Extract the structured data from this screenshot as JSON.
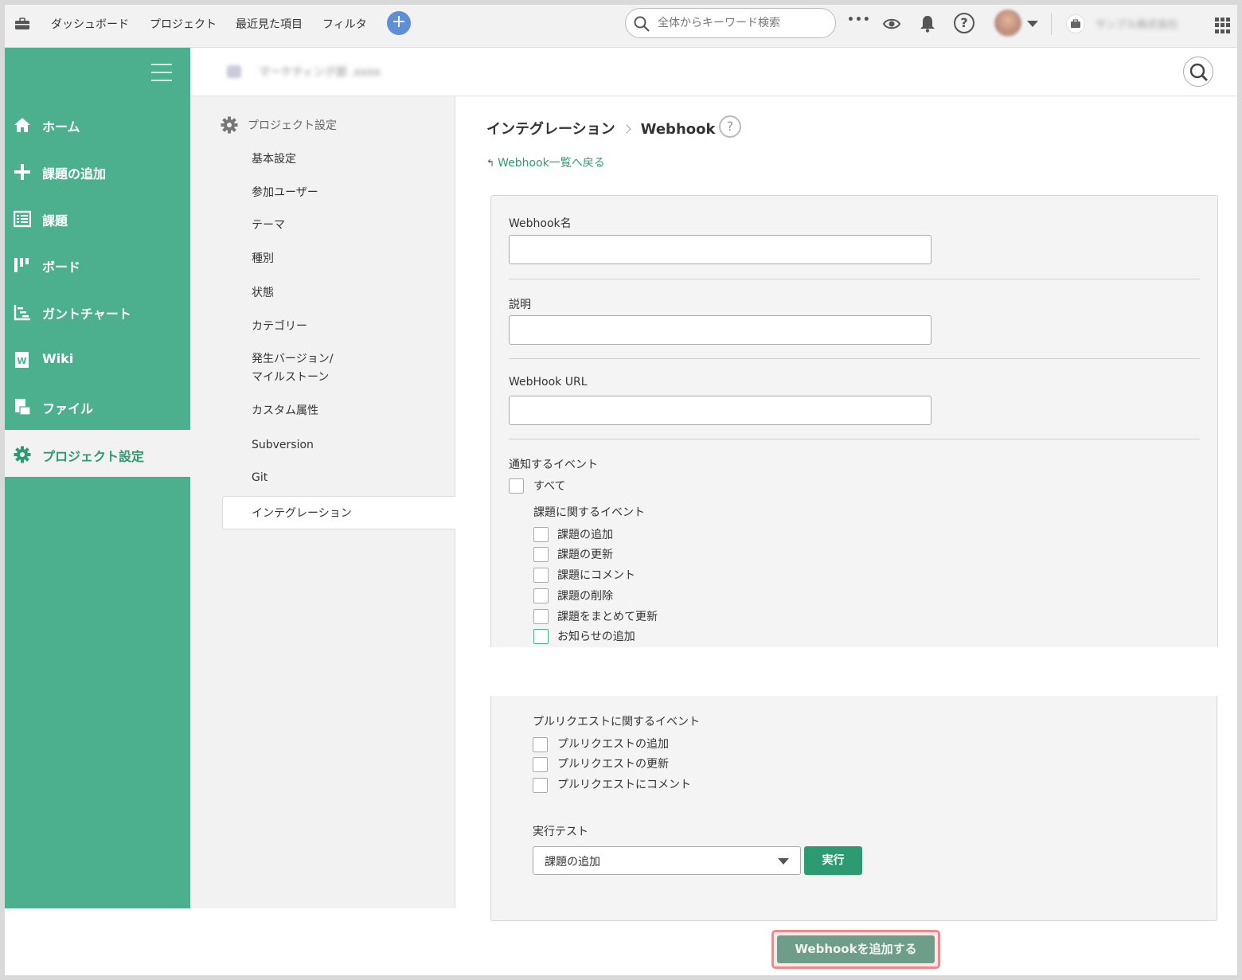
{
  "topbar": {
    "nav": [
      "ダッシュボード",
      "プロジェクト",
      "最近見た項目",
      "フィルタ"
    ],
    "add_label": "+",
    "search_placeholder": "全体からキーワード検索",
    "more_label": "•••",
    "help_label": "?",
    "space_name": "サンプル株式会社"
  },
  "sidebar": {
    "items": [
      {
        "label": "ホーム",
        "icon": "home-icon"
      },
      {
        "label": "課題の追加",
        "icon": "plus-icon"
      },
      {
        "label": "課題",
        "icon": "list-icon"
      },
      {
        "label": "ボード",
        "icon": "board-icon"
      },
      {
        "label": "ガントチャート",
        "icon": "gantt-icon"
      },
      {
        "label": "Wiki",
        "icon": "wiki-icon"
      },
      {
        "label": "ファイル",
        "icon": "file-icon"
      },
      {
        "label": "プロジェクト設定",
        "icon": "gear-icon",
        "active": true
      }
    ]
  },
  "project": {
    "name": "マーケティング部 .xxxx"
  },
  "subnav": {
    "title": "プロジェクト設定",
    "items": [
      "基本設定",
      "参加ユーザー",
      "テーマ",
      "種別",
      "状態",
      "カテゴリー",
      "発生バージョン/\nマイルストーン",
      "カスタム属性",
      "Subversion",
      "Git"
    ],
    "active": "インテグレーション"
  },
  "content": {
    "breadcrumb_parent": "インテグレーション",
    "breadcrumb_current": "Webhook",
    "help_label": "?",
    "back_link": "Webhook一覧へ戻る",
    "back_arrow": "↰",
    "form": {
      "name_label": "Webhook名",
      "name_value": "",
      "desc_label": "説明",
      "desc_value": "",
      "url_label": "WebHook URL",
      "url_value": "",
      "events_label": "通知するイベント",
      "all_label": "すべて",
      "issue_events_label": "課題に関するイベント",
      "issue_events": [
        "課題の追加",
        "課題の更新",
        "課題にコメント",
        "課題の削除",
        "課題をまとめて更新",
        "お知らせの追加"
      ],
      "pr_events_label": "プルリクエストに関するイベント",
      "pr_events": [
        "プルリクエストの追加",
        "プルリクエストの更新",
        "プルリクエストにコメント"
      ],
      "test_label": "実行テスト",
      "test_selected": "課題の追加",
      "run_label": "実行",
      "submit_label": "Webhookを追加する"
    }
  },
  "colors": {
    "brand": "#4caf8e",
    "accent": "#2e9a72",
    "highlight": "#f08a8a"
  }
}
